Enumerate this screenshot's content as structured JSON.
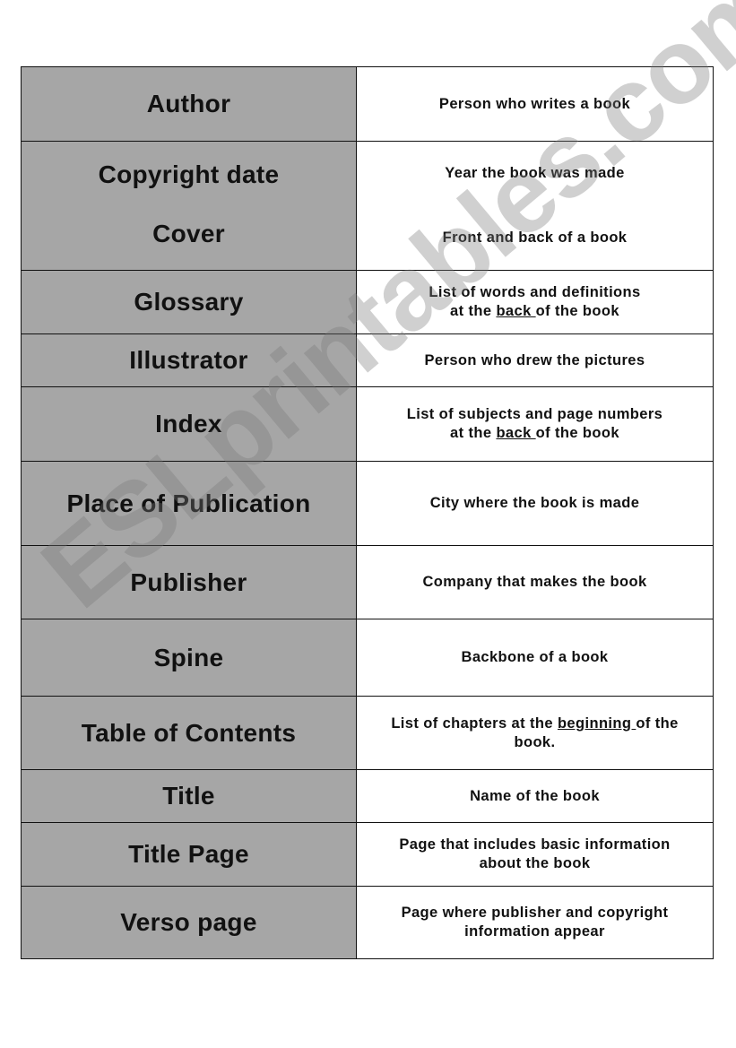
{
  "worksheet": {
    "rows": [
      {
        "term": "Author",
        "definition": [
          "Person who writes a book"
        ]
      },
      {
        "term": "Copyright date",
        "definition": [
          "Year the book was made"
        ]
      },
      {
        "term": "Cover",
        "definition": [
          "Front and back of a book"
        ]
      },
      {
        "term": "Glossary",
        "definition": [
          "List of words and definitions",
          "at the ",
          "back ",
          "of the book"
        ]
      },
      {
        "term": "Illustrator",
        "definition": [
          "Person who drew the pictures"
        ]
      },
      {
        "term": "Index",
        "definition": [
          "List of subjects and page numbers",
          "at the ",
          "back ",
          "of the book"
        ]
      },
      {
        "term": "Place of Publication",
        "definition": [
          "City where the book is made"
        ]
      },
      {
        "term": "Publisher",
        "definition": [
          "Company that makes the book"
        ]
      },
      {
        "term": "Spine",
        "definition": [
          "Backbone of a book"
        ]
      },
      {
        "term": "Table of Contents",
        "definition": [
          "List of chapters at the ",
          "beginning ",
          "of the",
          "book."
        ]
      },
      {
        "term": "Title",
        "definition": [
          "Name of the book"
        ]
      },
      {
        "term": "Title Page",
        "definition": [
          "Page that includes basic information",
          "about the book"
        ]
      },
      {
        "term": "Verso page",
        "definition": [
          "Page where publisher and copyright",
          "information appear"
        ]
      }
    ]
  },
  "watermark": "ESLprintables.com",
  "colors": {
    "term_cell": "#a6a6a6",
    "definition_cell": "#ffffff",
    "border": "#111111"
  }
}
